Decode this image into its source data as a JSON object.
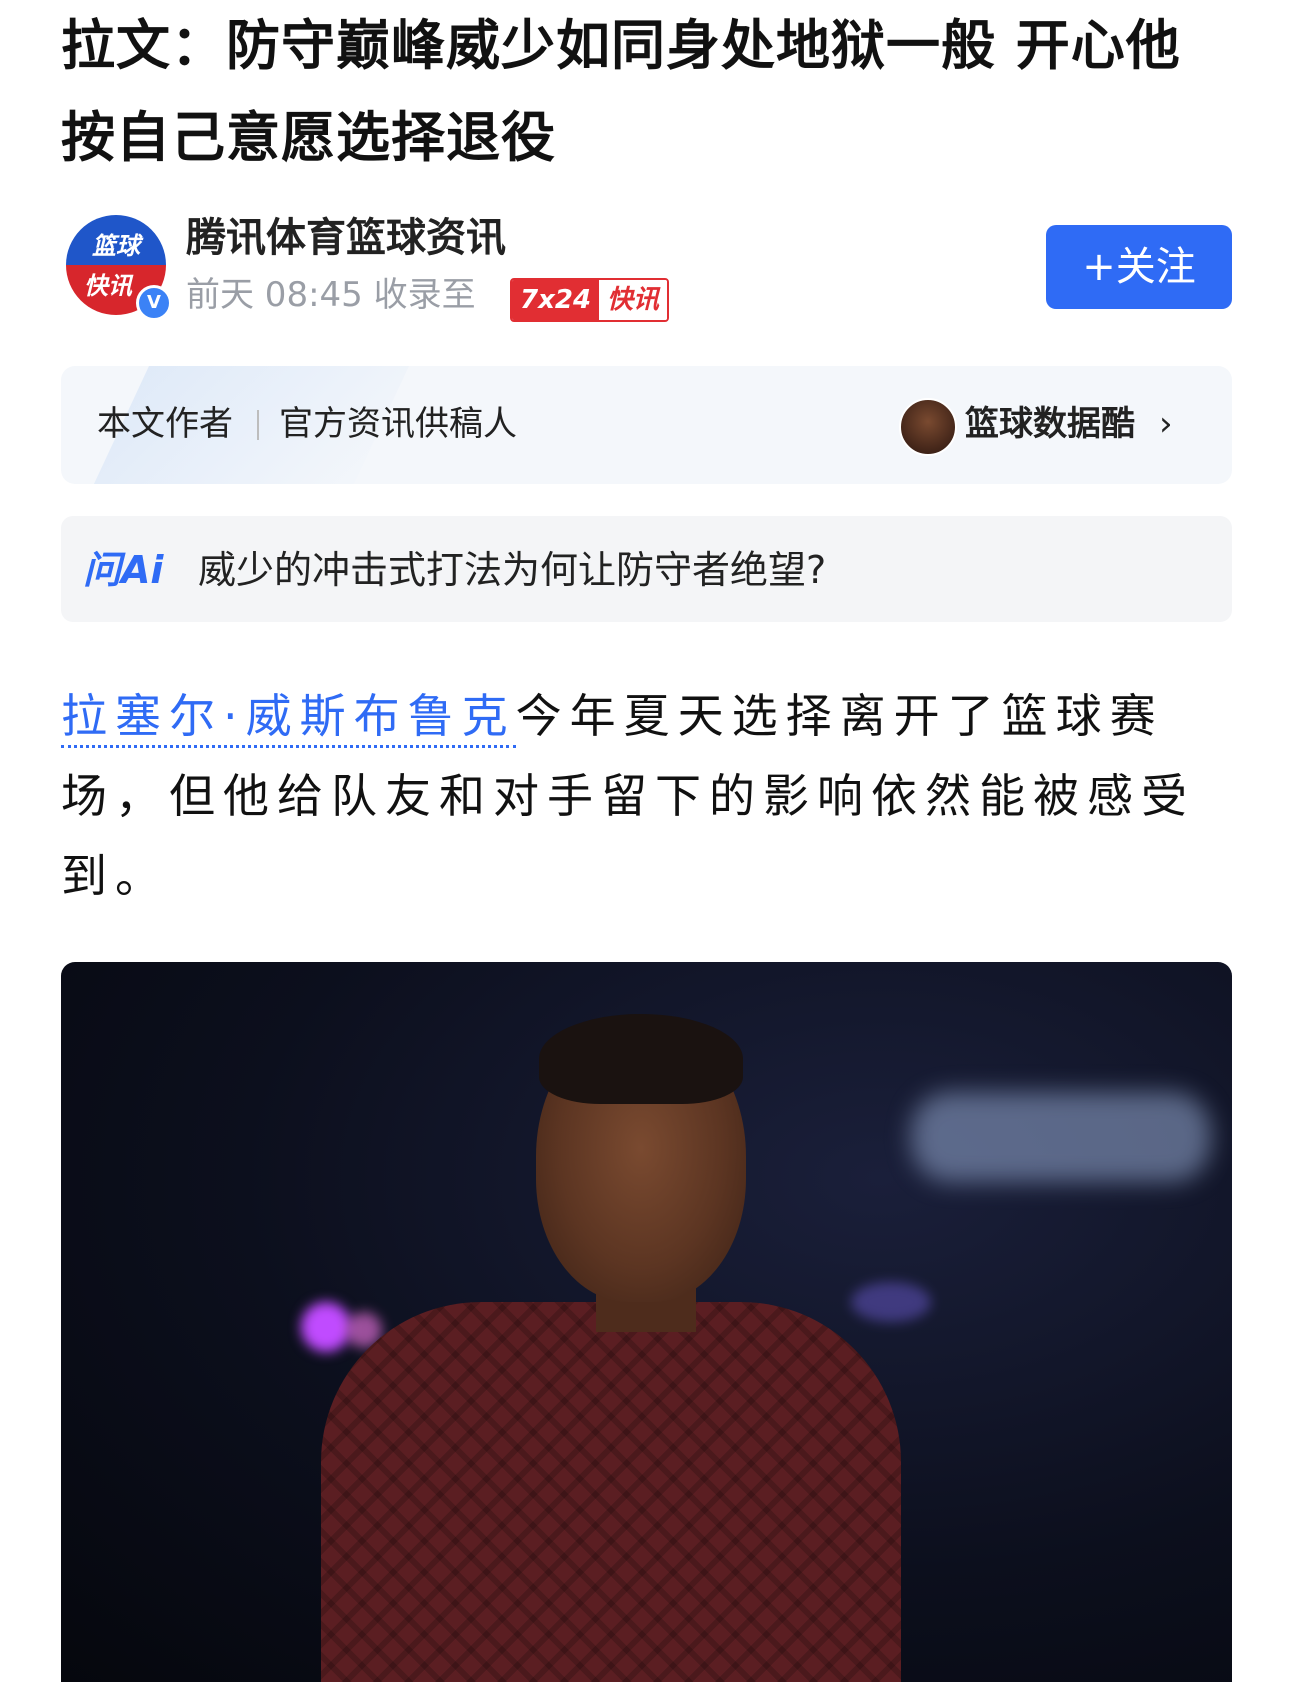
{
  "article": {
    "title": "拉文：防守巅峰威少如同身处地狱一般 开心他按自己意愿选择退役",
    "paragraph_link": "拉塞尔·威斯布鲁克",
    "paragraph_rest": "今年夏天选择离开了篮球赛场，但他给队友和对手留下的影响依然能被感受到。"
  },
  "source": {
    "avatar_line1": "篮球",
    "avatar_line2": "快讯",
    "verified_mark": "V",
    "name": "腾讯体育篮球资讯",
    "time_text": "前天 08:45 收录至",
    "badge_left": "7x24",
    "badge_right": "快讯",
    "follow_label": "+关注"
  },
  "author_card": {
    "label": "本文作者",
    "role": "官方资讯供稿人",
    "author_name": "篮球数据酷",
    "chevron": "›"
  },
  "ask_ai": {
    "logo": "问Ai",
    "question": "威少的冲击式打法为何让防守者绝望?"
  },
  "colors": {
    "accent": "#2f6bf5",
    "brand_red": "#e12e33",
    "muted_text": "#9a9ea6"
  },
  "icons": {
    "verified": "verified-check-icon",
    "chevron": "chevron-right-icon"
  }
}
